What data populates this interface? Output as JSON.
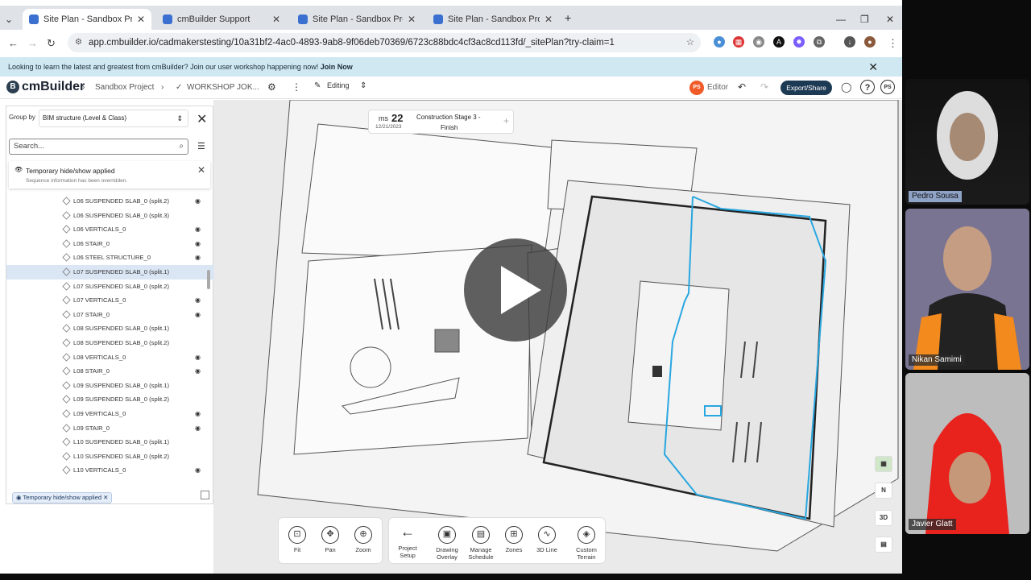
{
  "browser": {
    "tabs": [
      {
        "title": "Site Plan - Sandbox Project | cm"
      },
      {
        "title": "cmBuilder Support"
      },
      {
        "title": "Site Plan - Sandbox Project | cm"
      },
      {
        "title": "Site Plan - Sandbox Project | cm"
      }
    ],
    "new_tab": "+",
    "url": "app.cmbuilder.io/cadmakerstesting/10a31bf2-4ac0-4893-9ab8-9f06deb70369/6723c88bdc4cf3ac8cd113fd/_sitePlan?try-claim=1"
  },
  "banner": {
    "text": "Looking to learn the latest and greatest from cmBuilder? Join our user workshop happening now!",
    "link": "Join Now"
  },
  "header": {
    "logo": "cmBuilder",
    "crumb1": "Sandbox Project",
    "crumb2": "WORKSHOP JOK...",
    "mode": "Editing",
    "user_initials": "PS",
    "role": "Editor",
    "export_label": "Export/Share",
    "profile_initials": "PS"
  },
  "panel": {
    "group_by_label": "Group by",
    "group_by_value": "BIM structure (Level & Class)",
    "search_placeholder": "Search...",
    "notice_title": "Temporary hide/show applied",
    "notice_sub": "Sequence information has been overridden.",
    "items": [
      {
        "label": "L06 SUSPENDED SLAB_0 (split.2)",
        "vis": true
      },
      {
        "label": "L06 SUSPENDED SLAB_0 (split.3)",
        "vis": false
      },
      {
        "label": "L06 VERTICALS_0",
        "vis": true
      },
      {
        "label": "L06 STAIR_0",
        "vis": true
      },
      {
        "label": "L06 STEEL STRUCTURE_0",
        "vis": true
      },
      {
        "label": "L07 SUSPENDED SLAB_0 (split.1)",
        "vis": false
      },
      {
        "label": "L07 SUSPENDED SLAB_0 (split.2)",
        "vis": false
      },
      {
        "label": "L07 VERTICALS_0",
        "vis": true
      },
      {
        "label": "L07 STAIR_0",
        "vis": true
      },
      {
        "label": "L08 SUSPENDED SLAB_0 (split.1)",
        "vis": false
      },
      {
        "label": "L08 SUSPENDED SLAB_0 (split.2)",
        "vis": false
      },
      {
        "label": "L08 VERTICALS_0",
        "vis": true
      },
      {
        "label": "L08 STAIR_0",
        "vis": true
      },
      {
        "label": "L09 SUSPENDED SLAB_0 (split.1)",
        "vis": false
      },
      {
        "label": "L09 SUSPENDED SLAB_0 (split.2)",
        "vis": false
      },
      {
        "label": "L09 VERTICALS_0",
        "vis": true
      },
      {
        "label": "L09 STAIR_0",
        "vis": true
      },
      {
        "label": "L10 SUSPENDED SLAB_0 (split.1)",
        "vis": false
      },
      {
        "label": "L10 SUSPENDED SLAB_0 (split.2)",
        "vis": false
      },
      {
        "label": "L10 VERTICALS_0",
        "vis": true
      }
    ],
    "selected_index": 5,
    "chip": "Temporary hide/show applied"
  },
  "stage": {
    "prefix": "ms",
    "number": "22",
    "date": "12/21/2023",
    "name_line1": "Construction Stage 3 -",
    "name_line2": "Finish"
  },
  "toolbar_left": [
    {
      "label": "Fit",
      "icon": "fit-icon"
    },
    {
      "label": "Pan",
      "icon": "pan-icon"
    },
    {
      "label": "Zoom",
      "icon": "zoom-icon"
    }
  ],
  "toolbar_right": [
    {
      "label": "Project Setup",
      "icon": "back-arrow-icon"
    },
    {
      "label": "Drawing Overlay",
      "icon": "overlay-icon"
    },
    {
      "label": "Manage Schedule",
      "icon": "schedule-icon"
    },
    {
      "label": "Zones",
      "icon": "zones-icon"
    },
    {
      "label": "3D Line",
      "icon": "line-icon"
    },
    {
      "label": "Custom Terrain",
      "icon": "terrain-icon"
    }
  ],
  "side_controls": {
    "north": "N",
    "view3d": "3D"
  },
  "participants": [
    {
      "name": "Pedro Sousa"
    },
    {
      "name": "Nikan Samimi"
    },
    {
      "name": "Javier Glatt"
    }
  ],
  "colors": {
    "accent": "#1d3a55",
    "zone_outline": "#29a7e0",
    "editor_badge": "#f05a28"
  }
}
